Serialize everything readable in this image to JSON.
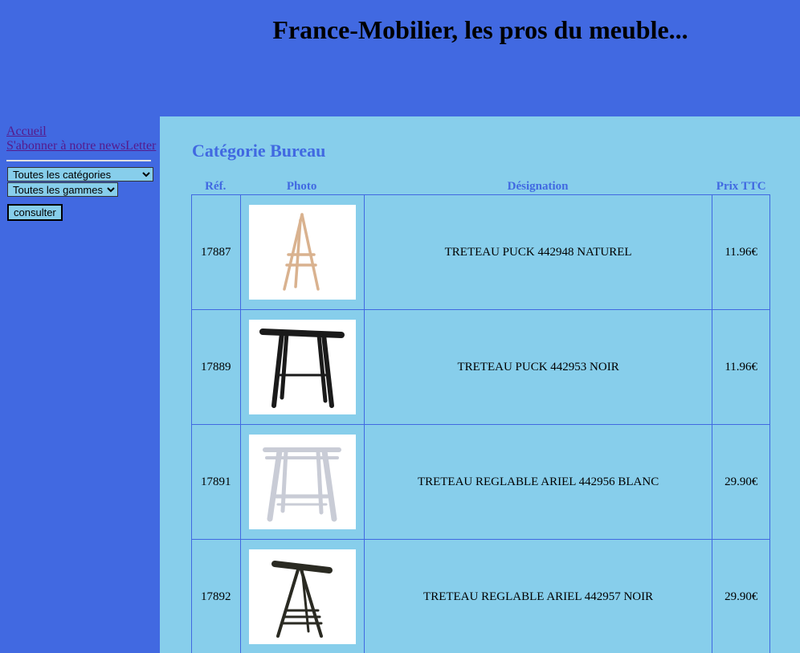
{
  "header": {
    "title": "France-Mobilier, les pros du meuble..."
  },
  "sidebar": {
    "links": [
      "Accueil",
      "S'abonner à notre newsLetter"
    ],
    "category_select": "Toutes les catégories",
    "range_select": "Toutes les gammes",
    "consult_button": "consulter"
  },
  "main": {
    "category_title": "Catégorie Bureau",
    "columns": [
      "Réf.",
      "Photo",
      "Désignation",
      "Prix TTC"
    ],
    "rows": [
      {
        "ref": "17887",
        "designation": "TRETEAU PUCK 442948 NATUREL",
        "price": "11.96€"
      },
      {
        "ref": "17889",
        "designation": "TRETEAU PUCK 442953 NOIR",
        "price": "11.96€"
      },
      {
        "ref": "17891",
        "designation": "TRETEAU REGLABLE ARIEL 442956 BLANC",
        "price": "29.90€"
      },
      {
        "ref": "17892",
        "designation": "TRETEAU REGLABLE ARIEL 442957 NOIR",
        "price": "29.90€"
      }
    ]
  },
  "colors": {
    "page_bg": "#4169e1",
    "content_bg": "#87ceeb",
    "heading": "#4169e1",
    "link": "#551a8b"
  }
}
